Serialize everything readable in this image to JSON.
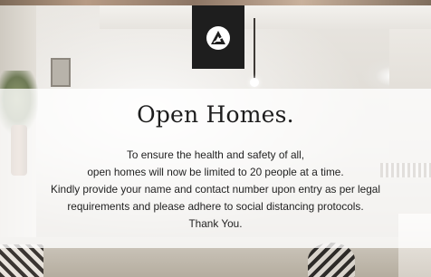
{
  "notice": {
    "heading": "Open Homes.",
    "lines": [
      "To ensure the health and safety of all,",
      "open homes will now be limited to 20 people at a time.",
      "Kindly provide your name and contact number upon entry as per legal",
      "requirements and please adhere to social distancing protocols.",
      "Thank You."
    ]
  },
  "logo": {
    "icon": "triangle-logo-icon",
    "background_color": "#1e1e1e",
    "mark_color": "#ffffff"
  },
  "colors": {
    "panel_overlay": "#ffffff",
    "text": "#1f1f1f"
  }
}
